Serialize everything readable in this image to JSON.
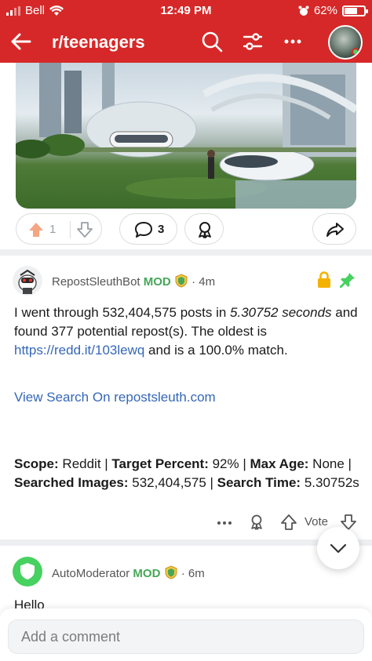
{
  "status_bar": {
    "carrier": "Bell",
    "time": "12:49 PM",
    "battery": "62%"
  },
  "header": {
    "subreddit": "r/teenagers"
  },
  "post_actions": {
    "upvotes": "1",
    "comments": "3"
  },
  "comments": [
    {
      "username": "RepostSleuthBot",
      "mod_label": "MOD",
      "time": "4m",
      "body_p1_a": "I went through 532,404,575 posts in ",
      "body_p1_em1": "5.30752 seconds",
      "body_p1_b": " and found 377 potential repost(s). The oldest is ",
      "body_p1_link": "https://redd.it/103lewq",
      "body_p1_c": " and is a 100.0% match.",
      "body_p2_link": "View Search On repostsleuth.com",
      "scope_label": "Scope:",
      "scope_value": " Reddit | ",
      "target_label": "Target Percent:",
      "target_value": " 92% | ",
      "maxage_label": "Max Age:",
      "maxage_value": " None | ",
      "images_label": "Searched Images:",
      "images_value": " 532,404,575 | ",
      "time_label": "Search Time:",
      "time_value": " 5.30752s",
      "vote_label": "Vote"
    },
    {
      "username": "AutoModerator",
      "mod_label": "MOD",
      "time": "6m",
      "body": "Hello"
    }
  ],
  "comment_input": {
    "placeholder": "Add a comment"
  },
  "colors": {
    "header_bg": "#d62828",
    "mod_green": "#46a758",
    "link_blue": "#3567b8",
    "upvote_orange": "#f4a582",
    "lock_yellow": "#f5b100",
    "pin_green": "#46d160"
  }
}
